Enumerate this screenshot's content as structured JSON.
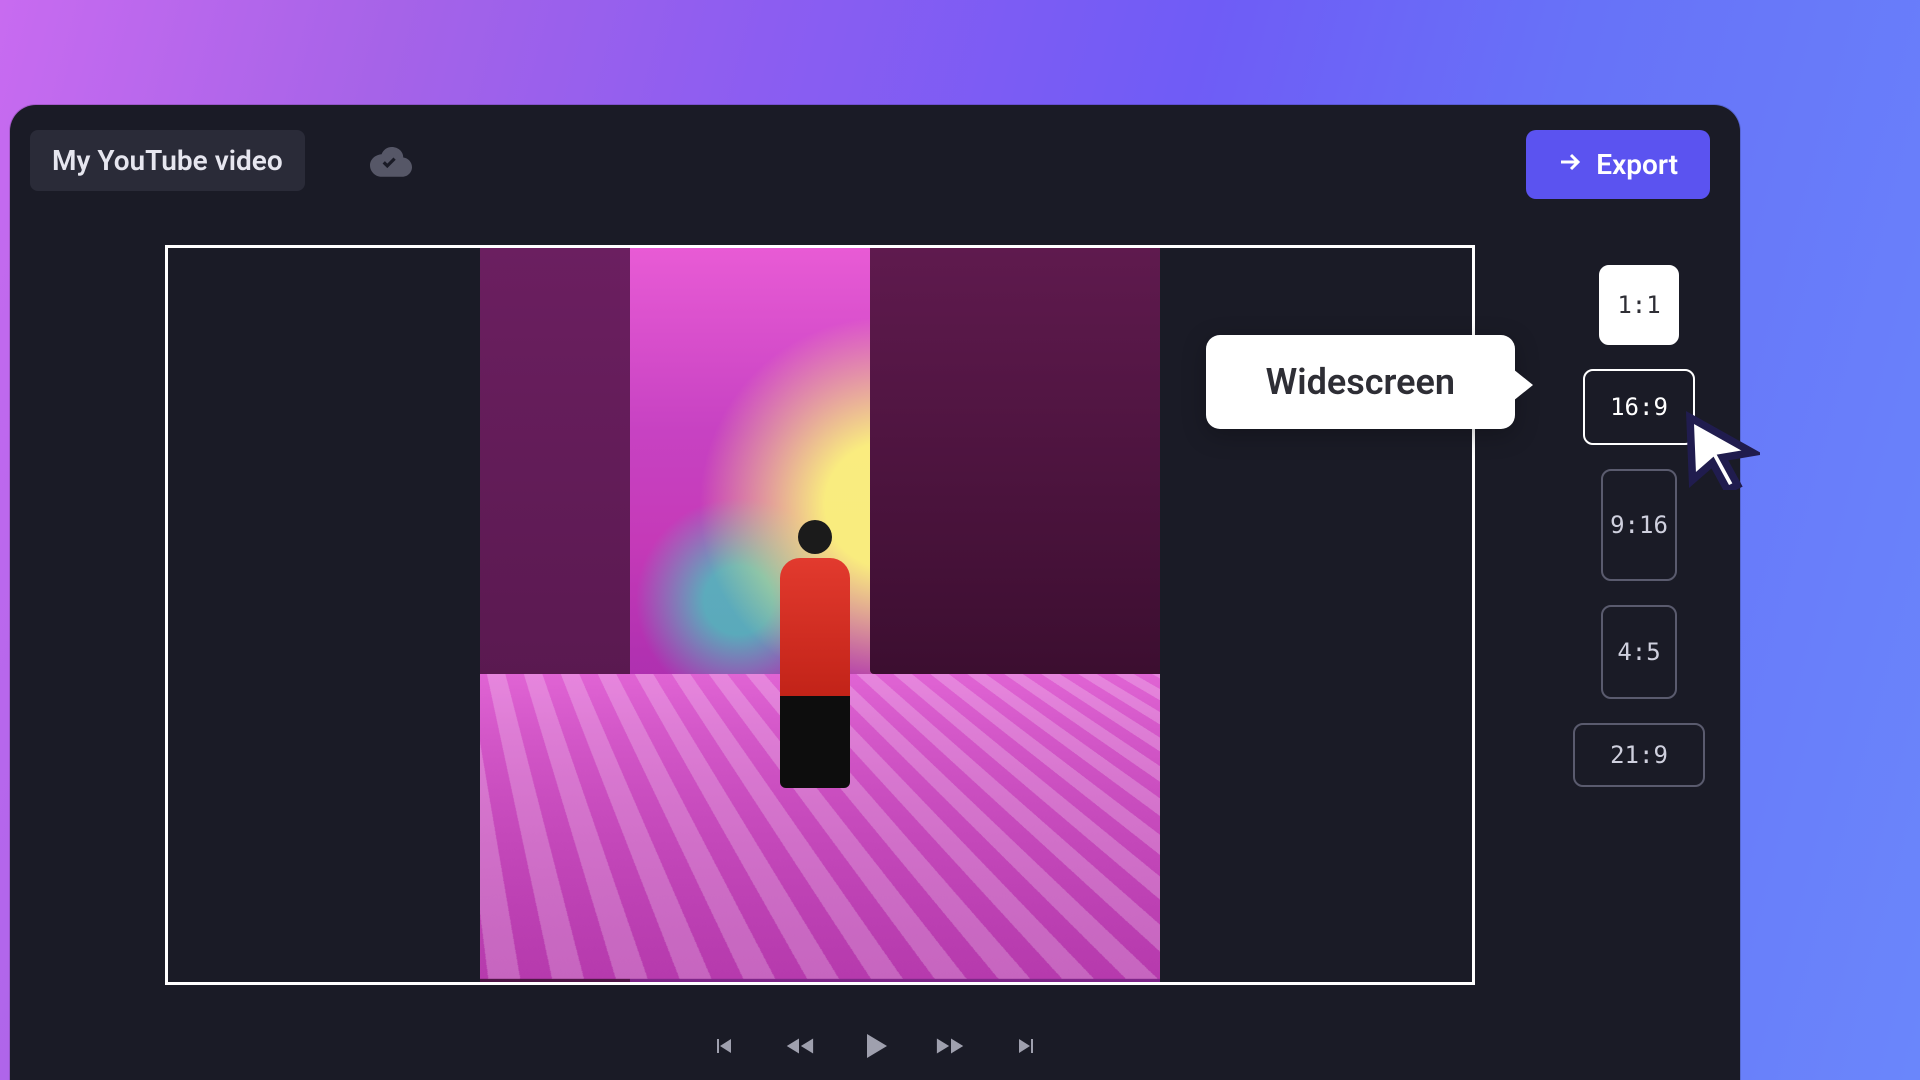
{
  "header": {
    "project_title": "My YouTube video",
    "export_label": "Export",
    "sync_status": "synced"
  },
  "tooltip": {
    "label": "Widescreen"
  },
  "aspect_ratios": {
    "options": [
      {
        "label": "1:1",
        "selected": false
      },
      {
        "label": "16:9",
        "selected": true
      },
      {
        "label": "9:16",
        "selected": false
      },
      {
        "label": "4:5",
        "selected": false
      },
      {
        "label": "21:9",
        "selected": false
      }
    ]
  },
  "playback": {
    "buttons": [
      "skip-start",
      "rewind",
      "play",
      "fast-forward",
      "skip-end"
    ]
  },
  "colors": {
    "panel_bg": "#1a1b26",
    "chip_bg": "#2a2b38",
    "accent": "#5b53f0",
    "border_muted": "#5a5b6e",
    "text": "#e6e6ef"
  }
}
